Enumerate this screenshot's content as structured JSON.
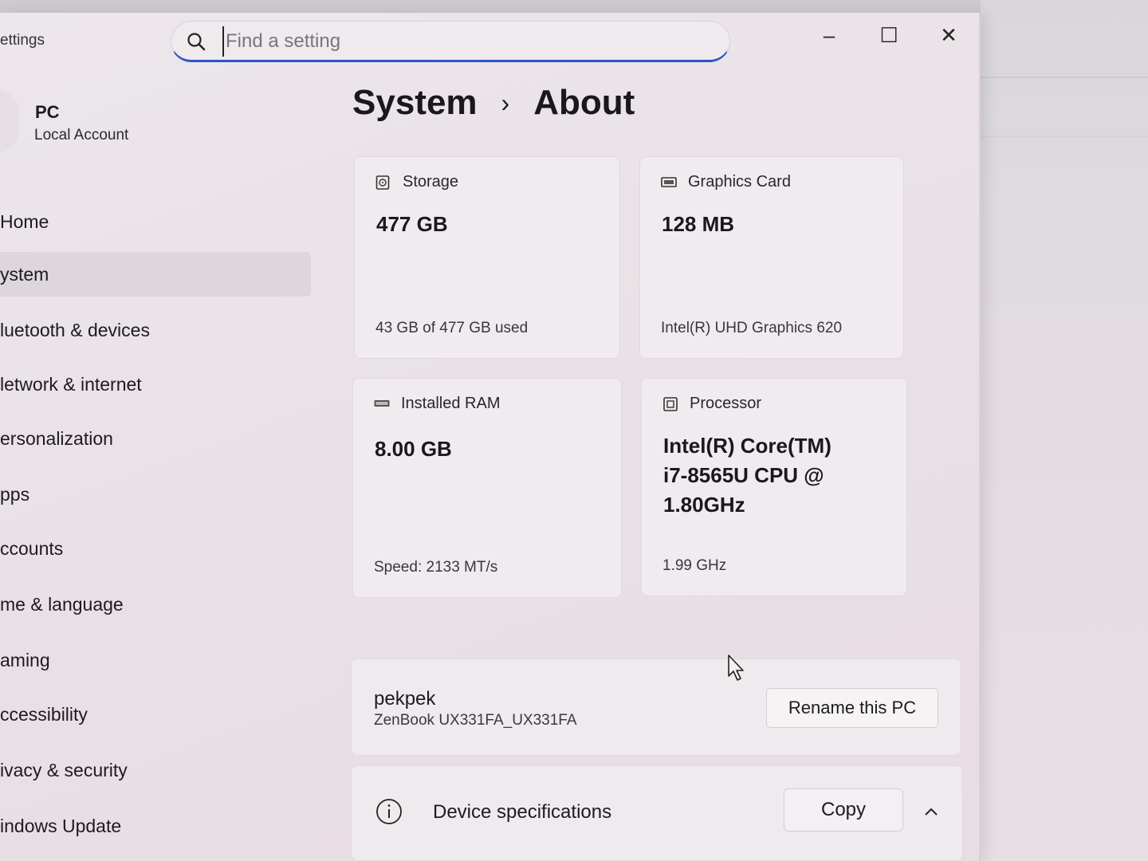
{
  "window": {
    "app_title": "ettings"
  },
  "search": {
    "placeholder": "Find a setting"
  },
  "window_controls": {
    "minimize": "–",
    "maximize": "☐",
    "close": "✕"
  },
  "profile": {
    "name": "PC",
    "account_type": "Local Account"
  },
  "sidebar": {
    "items": [
      {
        "label": "Home"
      },
      {
        "label": "System"
      },
      {
        "label": "Bluetooth & devices"
      },
      {
        "label": "Network & internet"
      },
      {
        "label": "Personalization"
      },
      {
        "label": "Apps"
      },
      {
        "label": "Accounts"
      },
      {
        "label": "Time & language"
      },
      {
        "label": "Gaming"
      },
      {
        "label": "Accessibility"
      },
      {
        "label": "Privacy & security"
      },
      {
        "label": "Windows Update"
      }
    ],
    "visible_labels": [
      "Home",
      "ystem",
      "luetooth & devices",
      "letwork & internet",
      "ersonalization",
      "pps",
      "ccounts",
      "me & language",
      "aming",
      "ccessibility",
      "ivacy & security",
      "indows Update"
    ],
    "active_index": 1
  },
  "breadcrumb": {
    "parent": "System",
    "separator": "›",
    "current": "About"
  },
  "cards": {
    "storage": {
      "label": "Storage",
      "value": "477 GB",
      "detail": "43 GB of 477 GB used",
      "icon": "storage-icon"
    },
    "graphics": {
      "label": "Graphics Card",
      "value": "128 MB",
      "detail": "Intel(R) UHD Graphics 620",
      "icon": "graphics-card-icon"
    },
    "ram": {
      "label": "Installed RAM",
      "value": "8.00 GB",
      "detail": "Speed: 2133 MT/s",
      "icon": "ram-icon"
    },
    "processor": {
      "label": "Processor",
      "value": "Intel(R) Core(TM) i7-8565U CPU @ 1.80GHz",
      "detail": "1.99 GHz",
      "icon": "processor-icon"
    }
  },
  "device": {
    "name": "pekpek",
    "model": "ZenBook UX331FA_UX331FA",
    "rename_label": "Rename this PC"
  },
  "specs": {
    "title": "Device specifications",
    "copy_label": "Copy",
    "expanded": true
  },
  "colors": {
    "accent": "#2a56c6",
    "window_bg": "#ebe4e9",
    "card_bg": "#efebee"
  }
}
